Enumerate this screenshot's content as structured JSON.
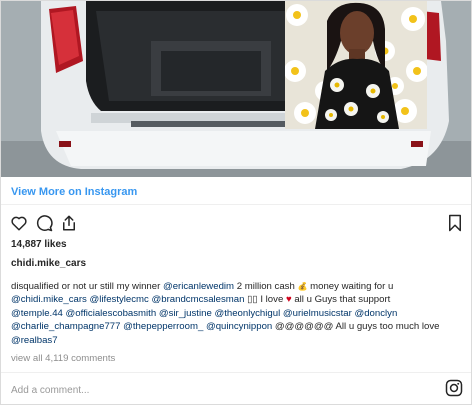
{
  "post": {
    "view_more_label": "View More on Instagram",
    "likes": "14,887 likes",
    "username": "chidi.mike_cars",
    "caption_lines": [
      [
        {
          "text": "disqualified or not ur still my winner ",
          "kind": "text"
        },
        {
          "text": "@ericanlewedim",
          "kind": "mention"
        },
        {
          "text": " 2 million cash ",
          "kind": "text"
        },
        {
          "text": "💰",
          "kind": "money"
        },
        {
          "text": " money waiting for u",
          "kind": "text"
        }
      ],
      [
        {
          "text": "@chidi.mike_cars",
          "kind": "mention"
        },
        {
          "text": " ",
          "kind": "text"
        },
        {
          "text": "@lifestylecmc",
          "kind": "mention"
        },
        {
          "text": " ",
          "kind": "text"
        },
        {
          "text": "@brandcmcsalesman",
          "kind": "mention"
        },
        {
          "text": " ▯▯ I love ",
          "kind": "text"
        },
        {
          "text": "♥",
          "kind": "heart"
        },
        {
          "text": " all u Guys that support",
          "kind": "text"
        }
      ],
      [
        {
          "text": "@temple.44",
          "kind": "mention"
        },
        {
          "text": " ",
          "kind": "text"
        },
        {
          "text": "@officialescobasmith",
          "kind": "mention"
        },
        {
          "text": " ",
          "kind": "text"
        },
        {
          "text": "@sir_justine",
          "kind": "mention"
        },
        {
          "text": " ",
          "kind": "text"
        },
        {
          "text": "@theonlychigul",
          "kind": "mention"
        },
        {
          "text": " ",
          "kind": "text"
        },
        {
          "text": "@urielmusicstar",
          "kind": "mention"
        },
        {
          "text": " ",
          "kind": "text"
        },
        {
          "text": "@donclyn",
          "kind": "mention"
        }
      ],
      [
        {
          "text": "@charlie_champagne777",
          "kind": "mention"
        },
        {
          "text": " ",
          "kind": "text"
        },
        {
          "text": "@thepepperroom_",
          "kind": "mention"
        },
        {
          "text": " ",
          "kind": "text"
        },
        {
          "text": "@quincynippon",
          "kind": "mention"
        },
        {
          "text": " @@@@@@ All u guys too much love",
          "kind": "text"
        }
      ],
      [
        {
          "text": "@realbas7",
          "kind": "mention"
        }
      ]
    ],
    "view_all_comments": "view all 4,119 comments",
    "comment_placeholder": "Add a comment..."
  },
  "icons": {
    "like": "heart-outline-icon",
    "comment": "comment-bubble-icon",
    "share": "share-icon",
    "save": "bookmark-icon",
    "logo": "instagram-logo-icon"
  },
  "colors": {
    "link_blue": "#3897f0",
    "mention": "#003569",
    "muted": "#8e8e8e",
    "text": "#262626",
    "heart_red": "#d0021b"
  }
}
